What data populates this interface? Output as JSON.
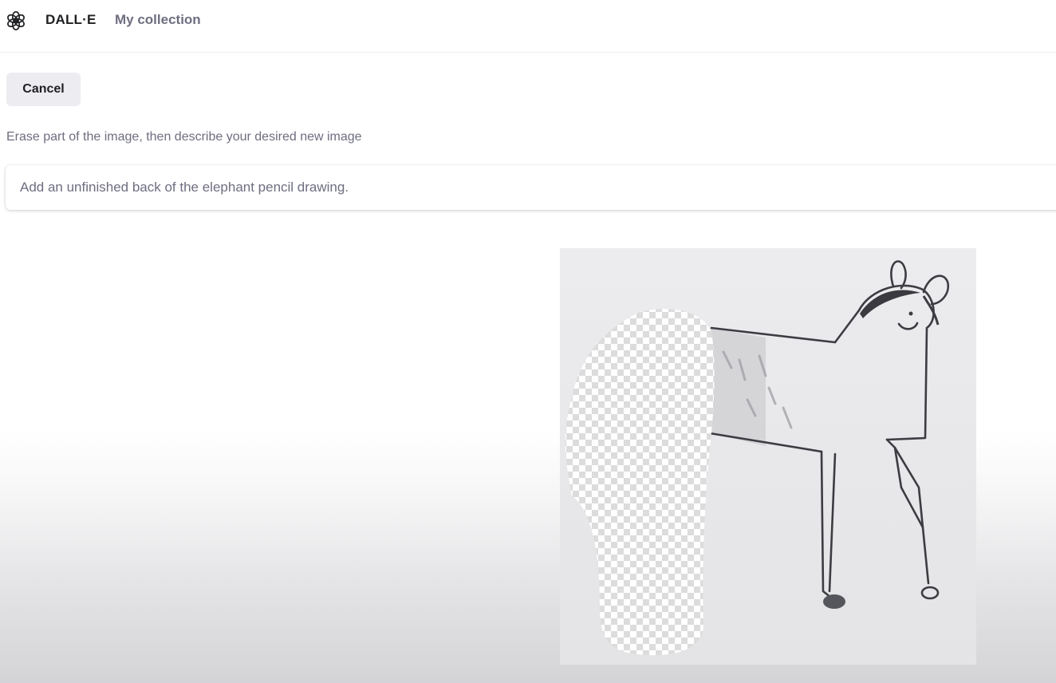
{
  "header": {
    "logo_icon": "openai-logo-icon",
    "brand": "DALL·E",
    "nav_link": "My collection"
  },
  "editor": {
    "cancel_label": "Cancel",
    "instruction": "Erase part of the image, then describe your desired new image",
    "prompt_value": "Add an unfinished back of the elephant pencil drawing."
  },
  "canvas": {
    "description_icon": "pencil-drawing-canvas",
    "erased_region_icon": "transparency-checkerboard"
  },
  "colors": {
    "text_primary": "#202123",
    "text_secondary": "#6e6e80",
    "button_bg": "#ececf1"
  }
}
